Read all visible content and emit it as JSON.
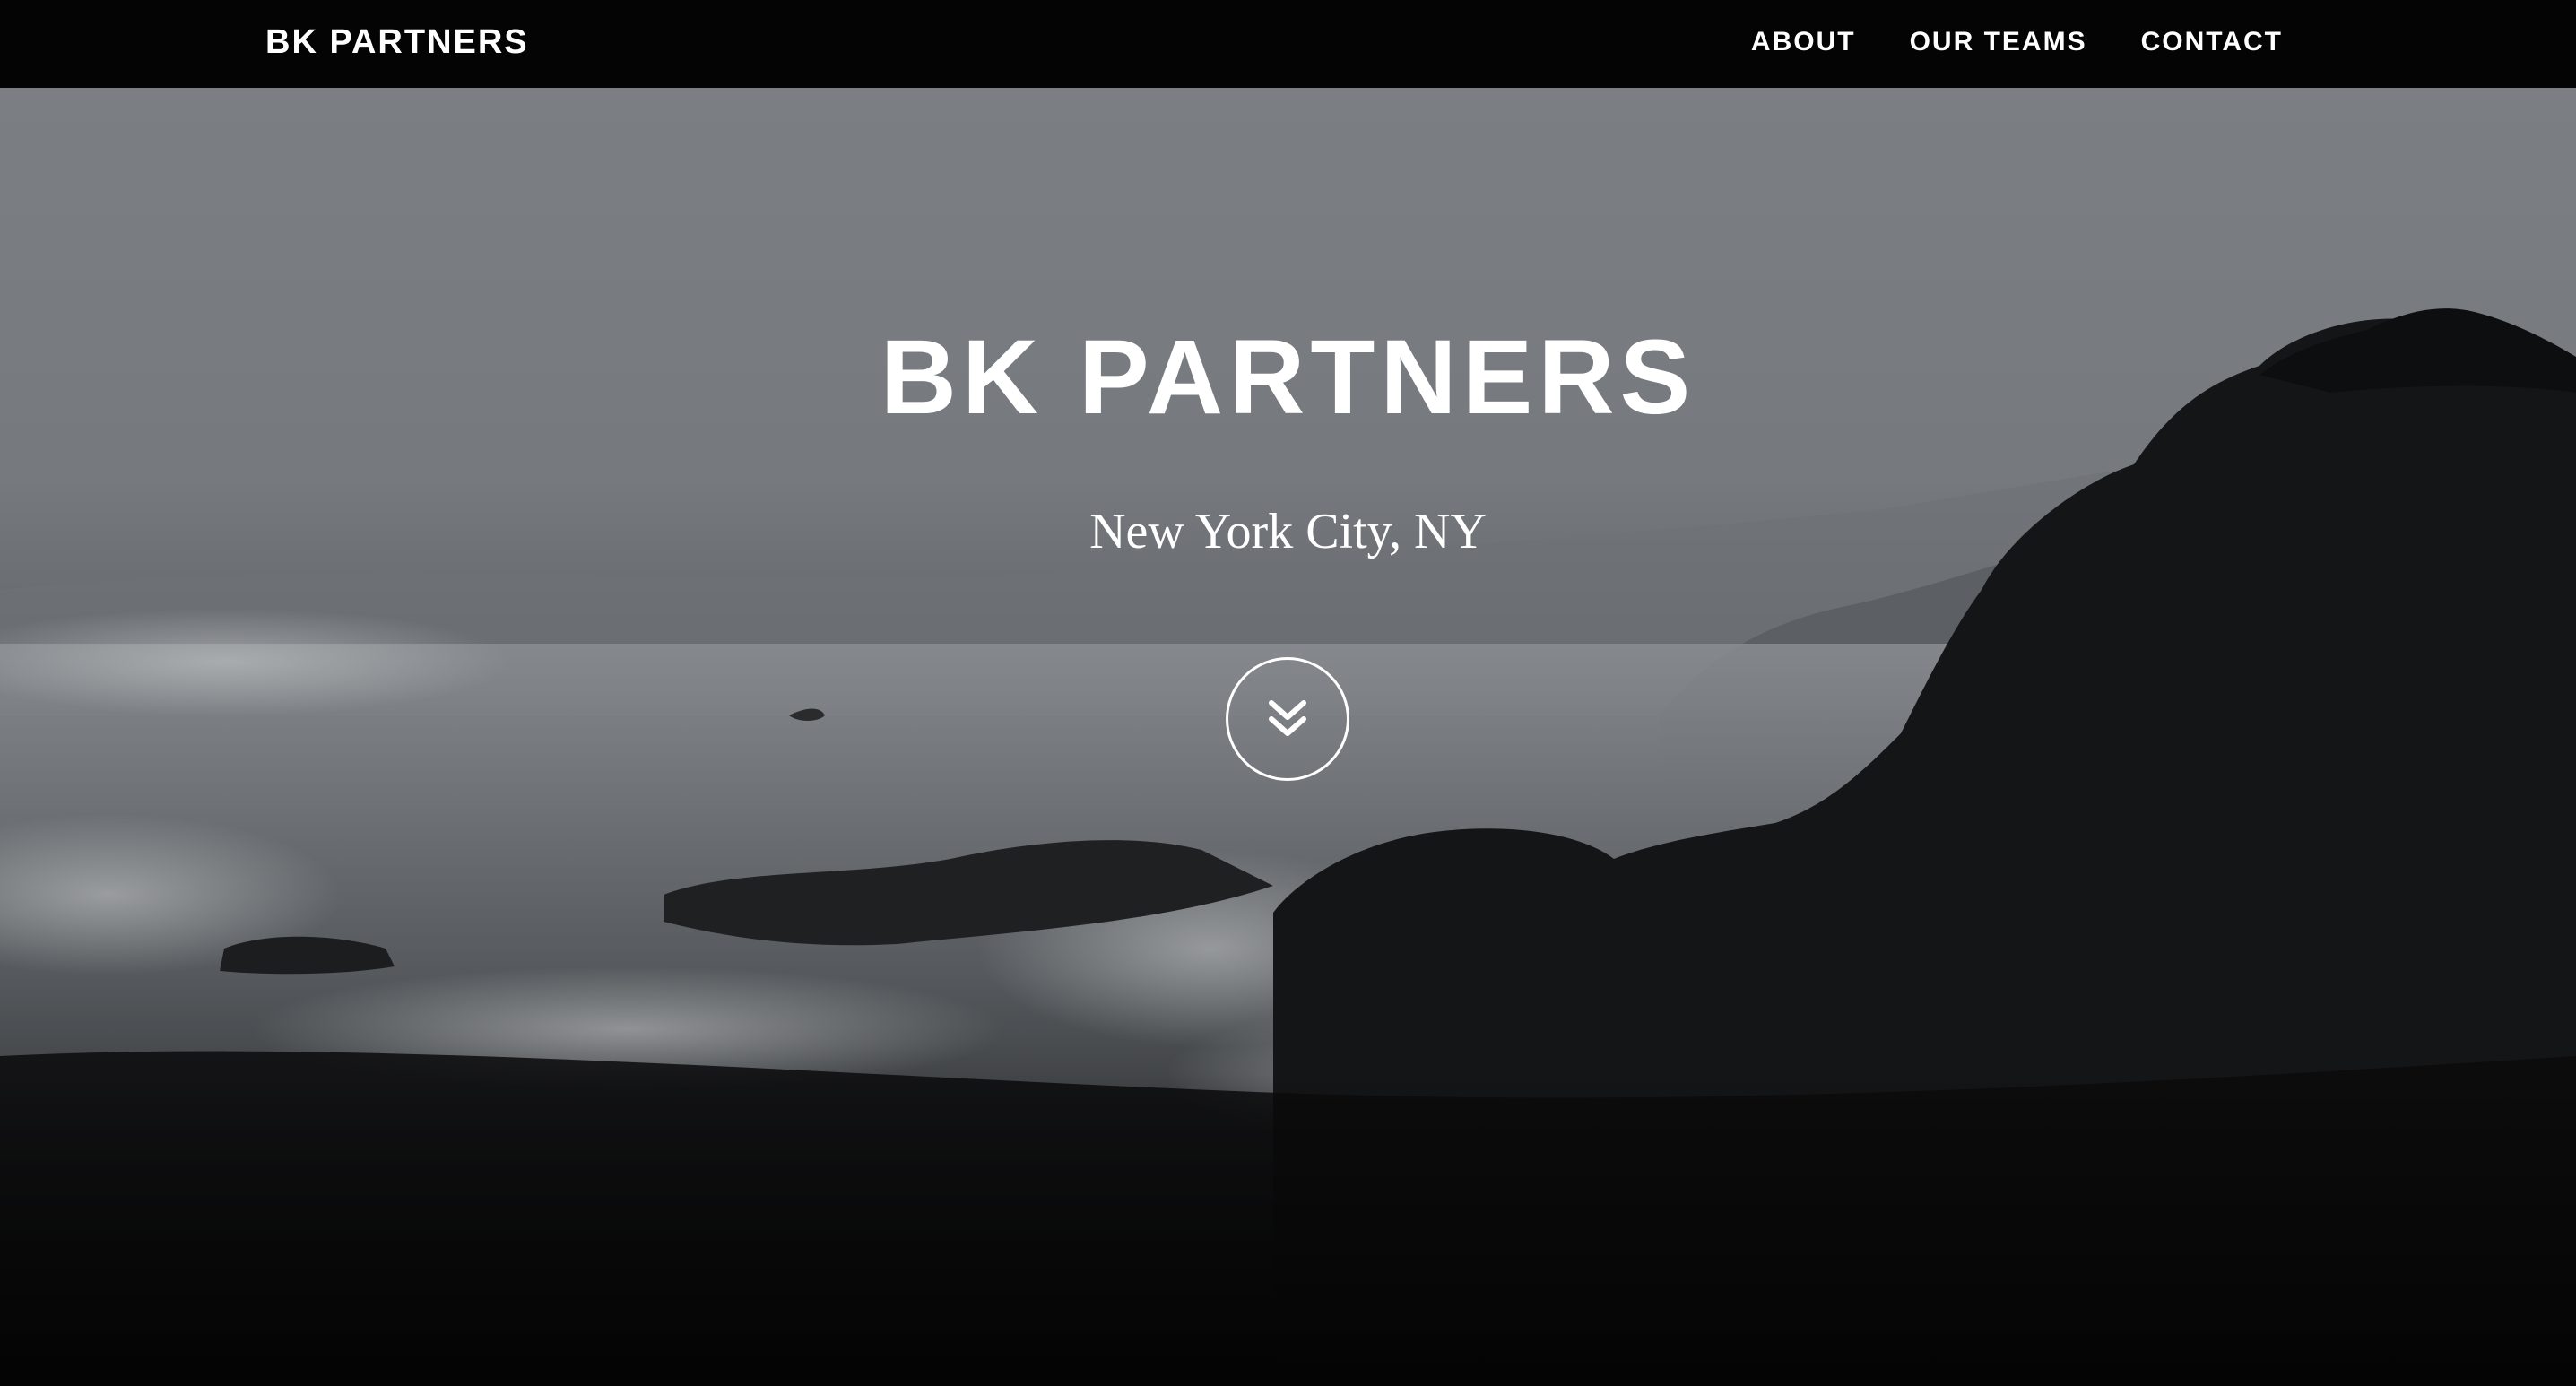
{
  "navbar": {
    "brand": "BK PARTNERS",
    "links": [
      "ABOUT",
      "OUR TEAMS",
      "CONTACT"
    ]
  },
  "hero": {
    "title": "BK PARTNERS",
    "subtitle": "New York City, NY",
    "scroll_icon": "double-chevron-down-icon",
    "background": "grayscale rocky coastline with crashing waves"
  },
  "colors": {
    "navbar_bg": "#040404",
    "text": "#ffffff",
    "page_bg": "#020202"
  }
}
